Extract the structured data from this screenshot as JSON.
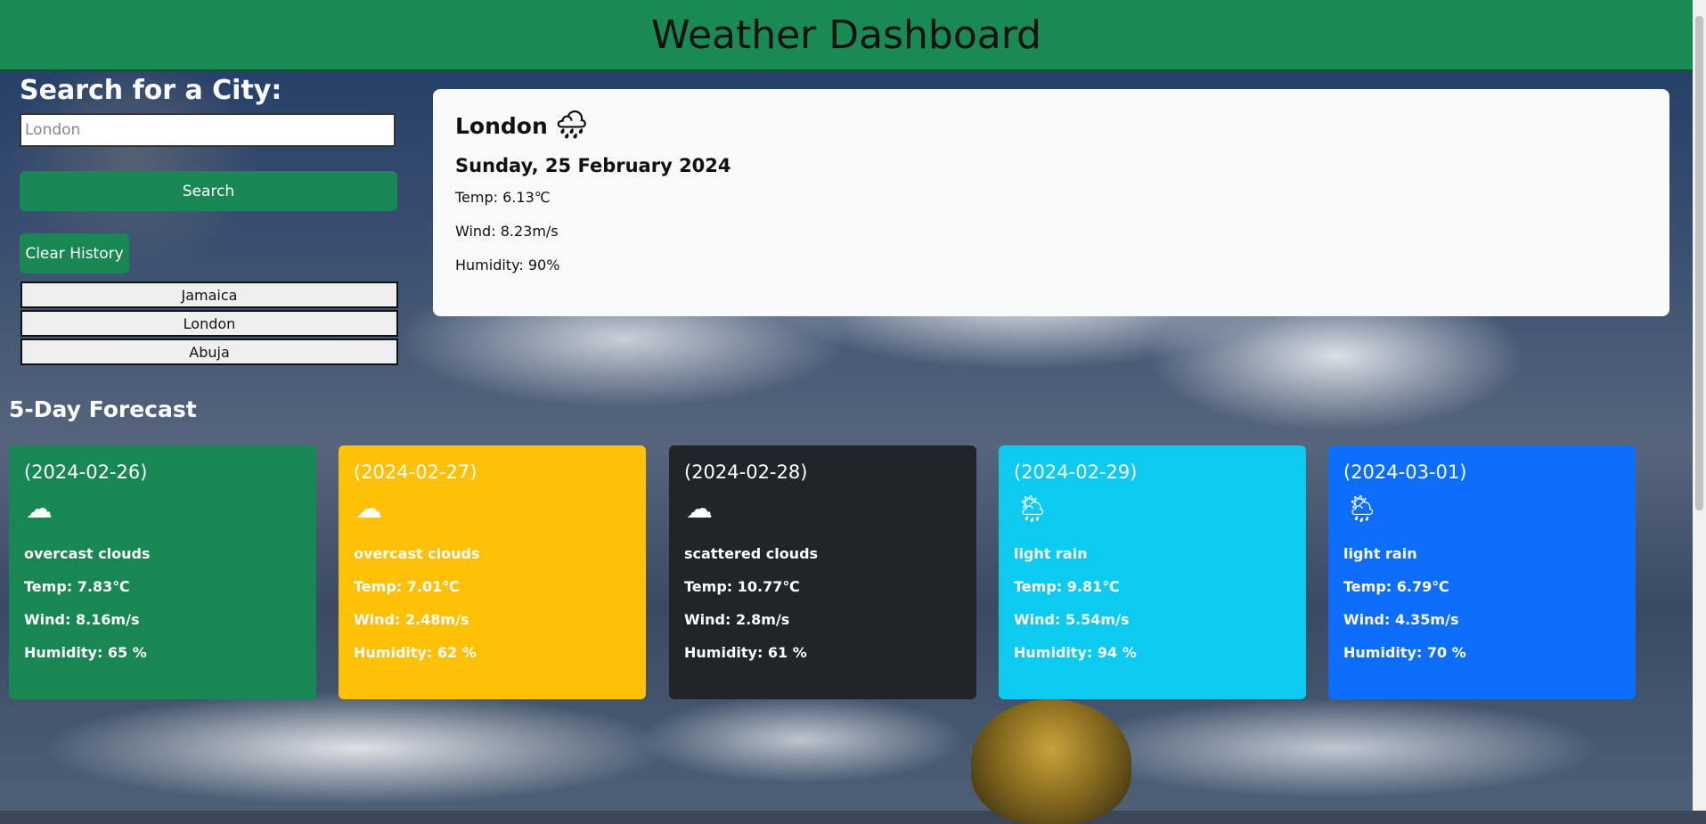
{
  "header": {
    "title": "Weather Dashboard",
    "color": "#1a8a55"
  },
  "search": {
    "title": "Search for a City:",
    "placeholder": "London",
    "button_label": "Search",
    "clear_label": "Clear History"
  },
  "history": [
    "Jamaica",
    "London",
    "Abuja"
  ],
  "current": {
    "city": "London",
    "icon": "rain-icon",
    "date": "Sunday, 25 February 2024",
    "temp": "Temp: 6.13℃",
    "wind": "Wind: 8.23m/s",
    "humidity": "Humidity: 90%"
  },
  "forecast": {
    "title": "5-Day Forecast",
    "days": [
      {
        "date": "(2024-02-26)",
        "icon": "cloud-icon",
        "desc": "overcast clouds",
        "temp": "Temp: 7.83℃",
        "wind": "Wind: 8.16m/s",
        "humidity": "Humidity: 65 %",
        "color": "#198754"
      },
      {
        "date": "(2024-02-27)",
        "icon": "cloud-icon",
        "desc": "overcast clouds",
        "temp": "Temp: 7.01℃",
        "wind": "Wind: 2.48m/s",
        "humidity": "Humidity: 62 %",
        "color": "#ffc107"
      },
      {
        "date": "(2024-02-28)",
        "icon": "cloud-icon",
        "desc": "scattered clouds",
        "temp": "Temp: 10.77℃",
        "wind": "Wind: 2.8m/s",
        "humidity": "Humidity: 61 %",
        "color": "#212529"
      },
      {
        "date": "(2024-02-29)",
        "icon": "sun-rain-icon",
        "desc": "light rain",
        "temp": "Temp: 9.81℃",
        "wind": "Wind: 5.54m/s",
        "humidity": "Humidity: 94 %",
        "color": "#0dcaf0"
      },
      {
        "date": "(2024-03-01)",
        "icon": "sun-rain-icon",
        "desc": "light rain",
        "temp": "Temp: 6.79℃",
        "wind": "Wind: 4.35m/s",
        "humidity": "Humidity: 70 %",
        "color": "#0d6efd"
      }
    ]
  }
}
